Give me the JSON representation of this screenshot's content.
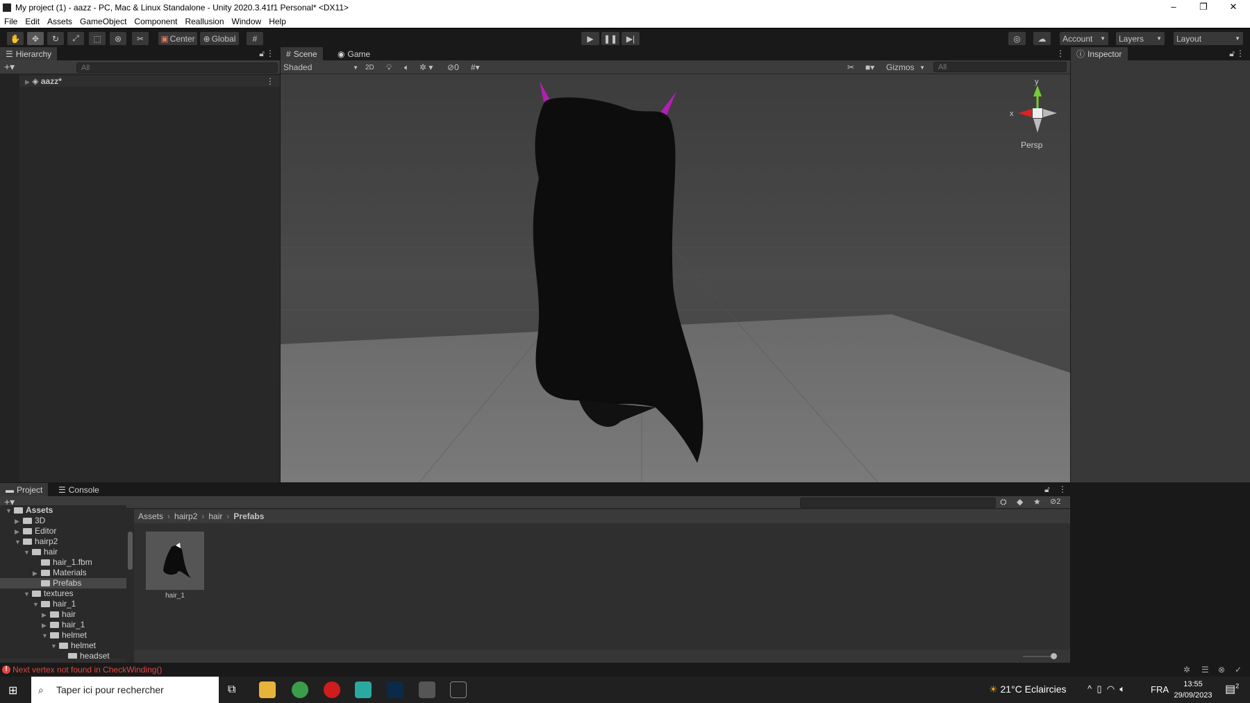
{
  "window": {
    "title": "My project (1) - aazz - PC, Mac & Linux Standalone - Unity 2020.3.41f1 Personal* <DX11>"
  },
  "menu": [
    "File",
    "Edit",
    "Assets",
    "GameObject",
    "Component",
    "Reallusion",
    "Window",
    "Help"
  ],
  "toolbar": {
    "center": "Center",
    "global": "Global",
    "account": "Account",
    "layers": "Layers",
    "layout": "Layout"
  },
  "hierarchy": {
    "tab": "Hierarchy",
    "search_placeholder": "All",
    "items": [
      {
        "label": "aazz*"
      }
    ]
  },
  "scene": {
    "tabs": [
      "Scene",
      "Game"
    ],
    "shading": "Shaded",
    "mode_2d": "2D",
    "hidden_count": "0",
    "gizmos": "Gizmos",
    "search_placeholder": "All",
    "persp": "Persp",
    "axis_y": "y",
    "axis_x": "x"
  },
  "inspector": {
    "tab": "Inspector"
  },
  "project": {
    "tabs": [
      "Project",
      "Console"
    ],
    "breadcrumb": [
      "Assets",
      "hairp2",
      "hair",
      "Prefabs"
    ],
    "hidden_count": "2",
    "tree": [
      {
        "label": "Assets",
        "depth": 0,
        "arrow": "▼"
      },
      {
        "label": "3D",
        "depth": 1,
        "arrow": "▶"
      },
      {
        "label": "Editor",
        "depth": 1,
        "arrow": "▶"
      },
      {
        "label": "hairp2",
        "depth": 1,
        "arrow": "▼"
      },
      {
        "label": "hair",
        "depth": 2,
        "arrow": "▼"
      },
      {
        "label": "hair_1.fbm",
        "depth": 3,
        "arrow": ""
      },
      {
        "label": "Materials",
        "depth": 3,
        "arrow": "▶"
      },
      {
        "label": "Prefabs",
        "depth": 3,
        "arrow": "",
        "selected": true
      },
      {
        "label": "textures",
        "depth": 2,
        "arrow": "▼"
      },
      {
        "label": "hair_1",
        "depth": 3,
        "arrow": "▼"
      },
      {
        "label": "hair",
        "depth": 4,
        "arrow": "▶"
      },
      {
        "label": "hair_1",
        "depth": 4,
        "arrow": "▶"
      },
      {
        "label": "helmet",
        "depth": 4,
        "arrow": "▼"
      },
      {
        "label": "helmet",
        "depth": 5,
        "arrow": "▼"
      },
      {
        "label": "headset",
        "depth": 6,
        "arrow": ""
      }
    ],
    "assets": [
      {
        "label": "hair_1"
      }
    ]
  },
  "status": {
    "message": "Next vertex not found in CheckWinding()"
  },
  "taskbar": {
    "search_placeholder": "Taper ici pour rechercher",
    "weather": "21°C  Eclaircies",
    "lang": "FRA",
    "time": "13:55",
    "date": "29/09/2023",
    "notifications": "2"
  },
  "colors": {
    "ear": "#b21fb3",
    "error": "#e04646",
    "selection": "#464646"
  }
}
